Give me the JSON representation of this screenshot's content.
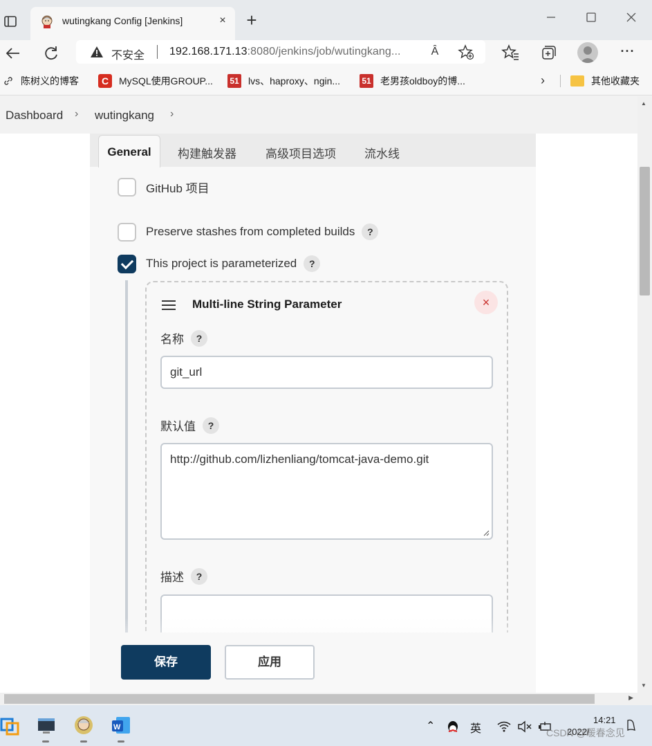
{
  "browser": {
    "tab_title": "wutingkang Config [Jenkins]",
    "tab_close": "×",
    "new_tab": "+",
    "insecure_label": "不安全",
    "url_host": "192.168.171.13",
    "url_port": ":8080",
    "url_path": "/jenkins/job/wutingkang...",
    "read_aloud": "Ȃ"
  },
  "favorites": [
    {
      "label": "陈树义的博客",
      "icon": "link-icon"
    },
    {
      "label": "MySQL使用GROUP...",
      "icon": "c-icon",
      "badge": "C"
    },
    {
      "label": "lvs、haproxy、ngin...",
      "icon": "51cto-icon",
      "badge": "51"
    },
    {
      "label": "老男孩oldboy的博...",
      "icon": "51cto-icon",
      "badge": "51"
    }
  ],
  "favorites_other": "其他收藏夹",
  "breadcrumb": [
    "Dashboard",
    "wutingkang"
  ],
  "config_tabs": [
    "General",
    "构建触发器",
    "高级项目选项",
    "流水线"
  ],
  "options": [
    {
      "label": "GitHub 项目",
      "checked": false,
      "help": false
    },
    {
      "label": "Preserve stashes from completed builds",
      "checked": false,
      "help": true
    },
    {
      "label": "This project is parameterized",
      "checked": true,
      "help": true
    }
  ],
  "help_mark": "?",
  "parameter": {
    "title": "Multi-line String Parameter",
    "remove": "×",
    "name_label": "名称",
    "name_value": "git_url",
    "default_label": "默认值",
    "default_value": "http://github.com/lizhenliang/tomcat-java-demo.git",
    "desc_label": "描述",
    "desc_value": ""
  },
  "buttons": {
    "save": "保存",
    "apply": "应用"
  },
  "taskbar": {
    "ime": "英",
    "time": "14:21",
    "date": "2022/",
    "watermark": "CSDN @暖春念见"
  }
}
